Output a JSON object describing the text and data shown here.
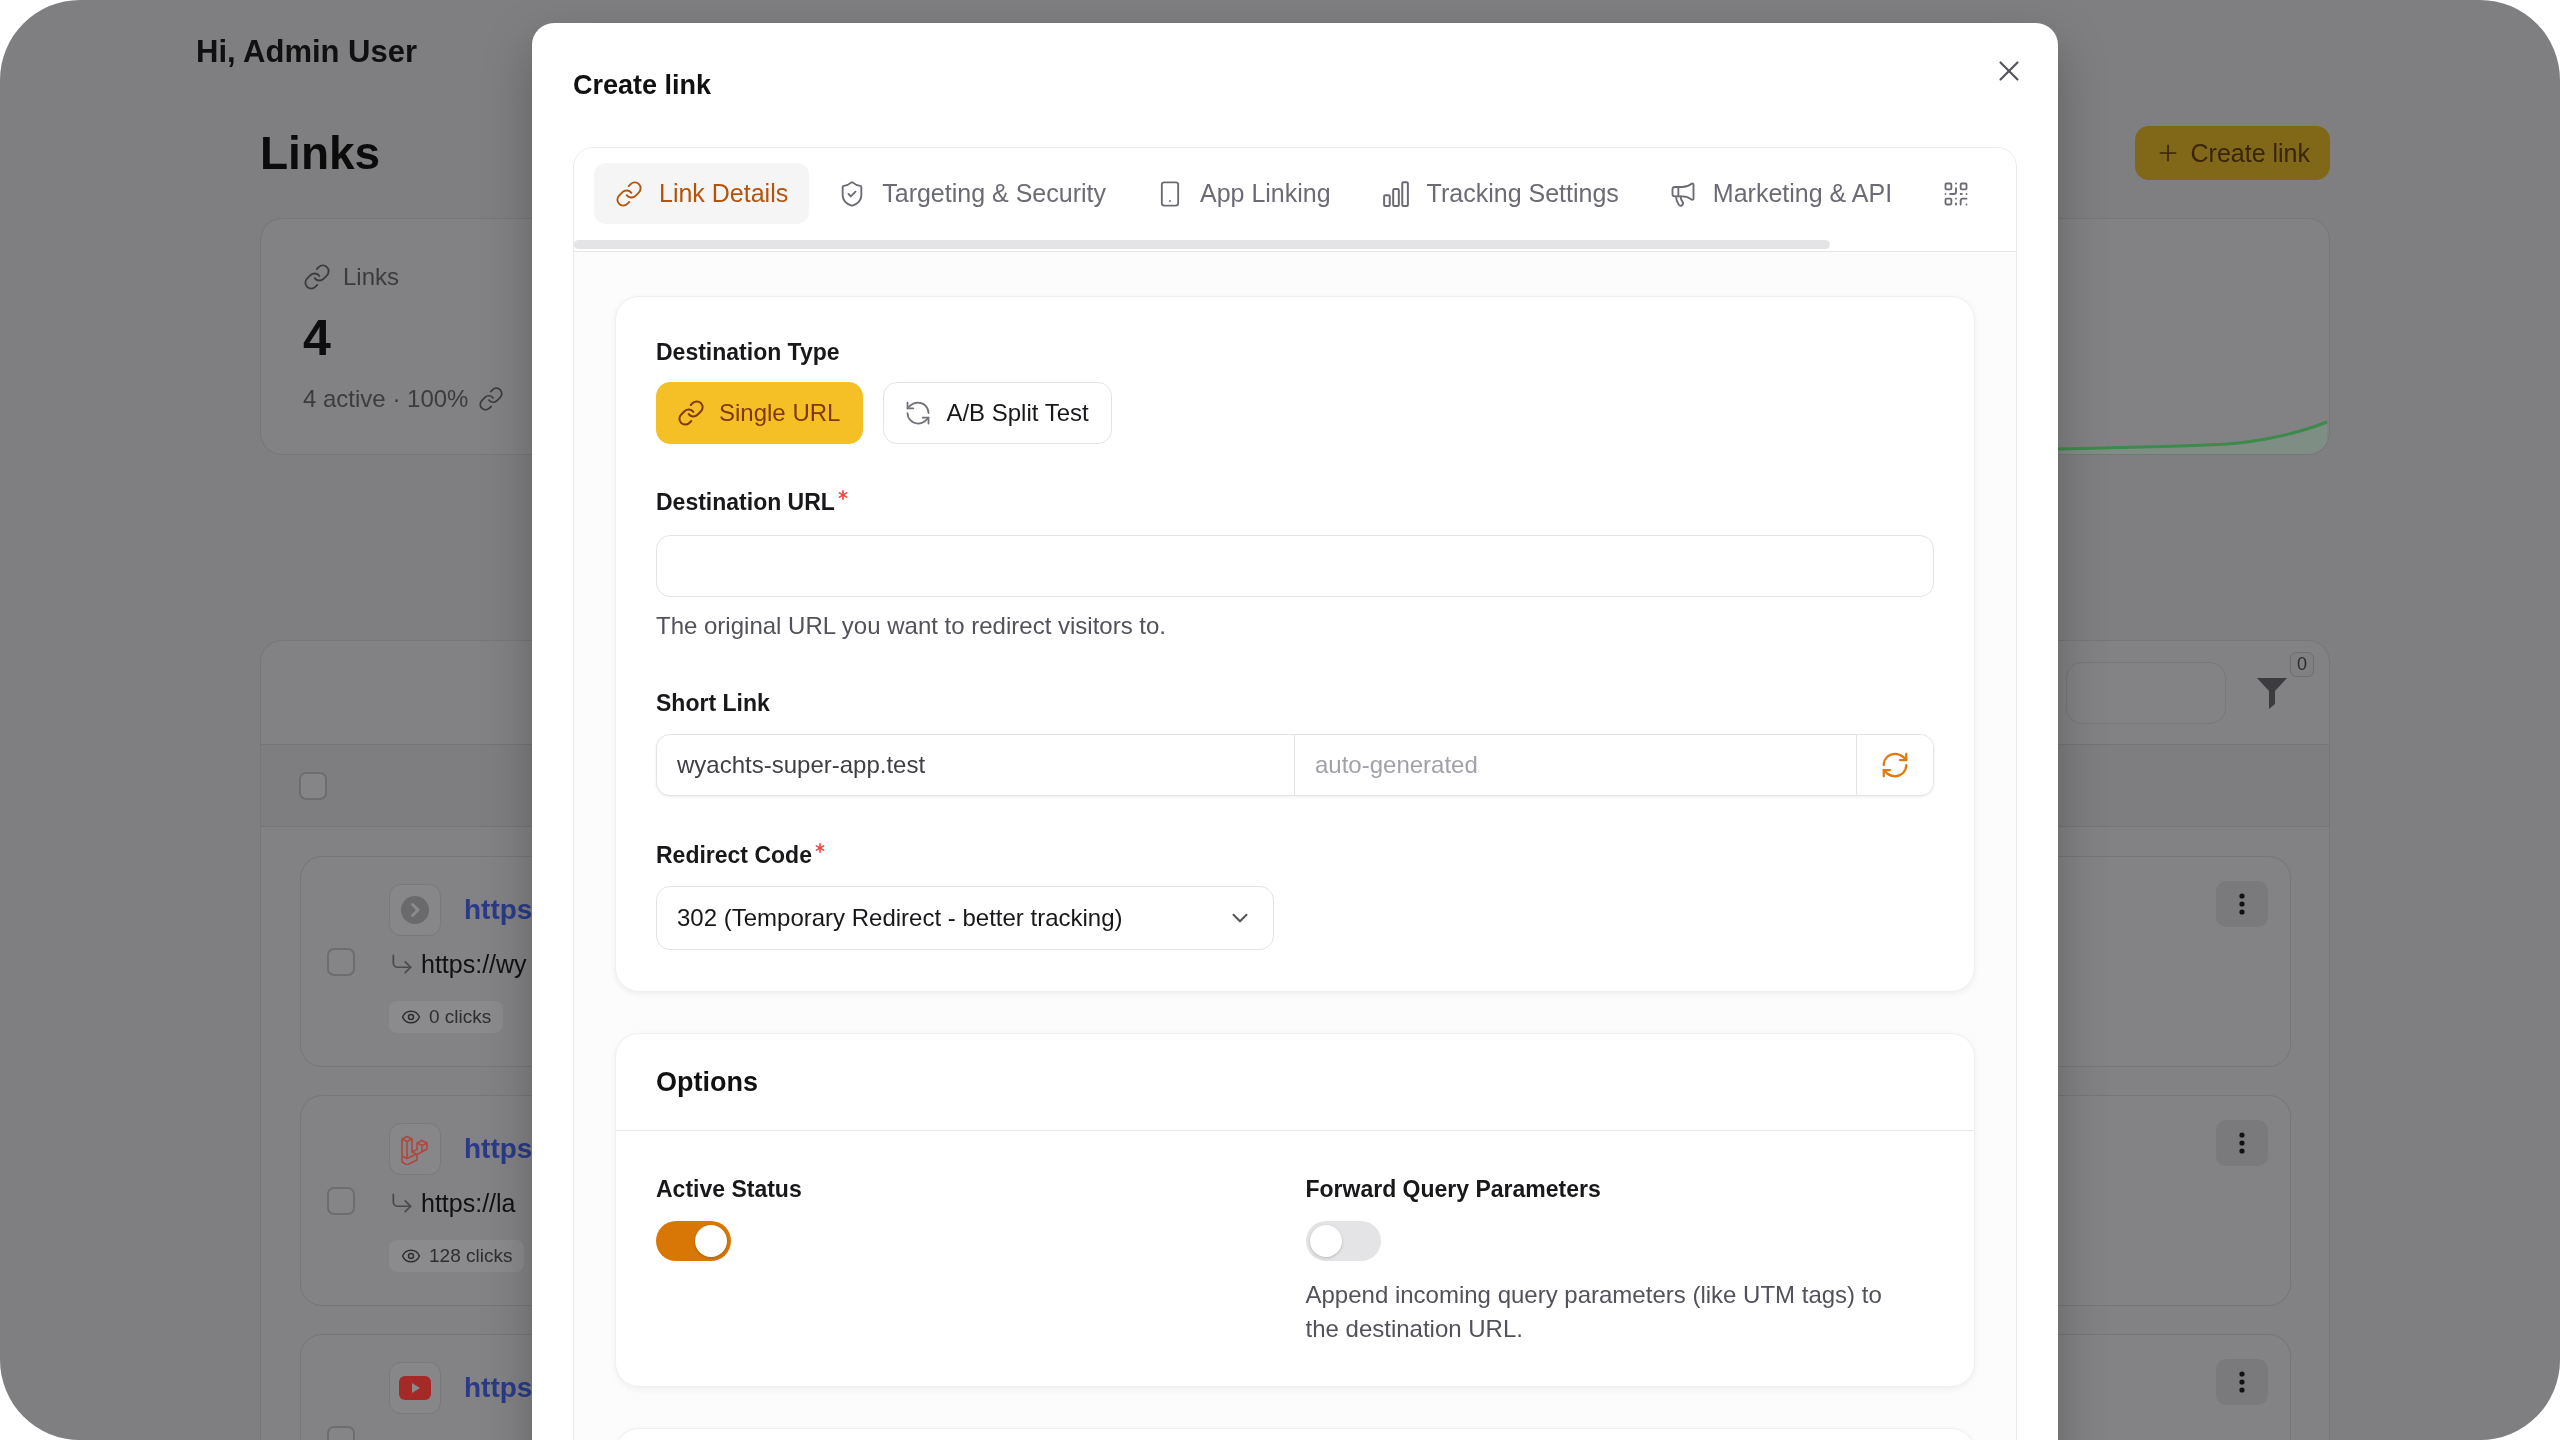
{
  "greeting": "Hi, Admin User",
  "header": {
    "title": "Links",
    "create_button": "Create link"
  },
  "stats": {
    "label": "Links",
    "value": "4",
    "detail": "4 active · 100%"
  },
  "table": {
    "filter_count": "0",
    "select_all": {
      "checked": false
    },
    "rows": [
      {
        "kind": "chevron",
        "title": "https",
        "destination": "https://wy",
        "clicks": "0 clicks",
        "checked": false
      },
      {
        "kind": "cubes",
        "title": "https",
        "destination": "https://la",
        "clicks": "128 clicks",
        "checked": false
      },
      {
        "kind": "play",
        "title": "https",
        "checked": false
      }
    ]
  },
  "modal": {
    "title": "Create link",
    "tabs": [
      {
        "label": "Link Details",
        "selected": true
      },
      {
        "label": "Targeting & Security",
        "selected": false
      },
      {
        "label": "App Linking",
        "selected": false
      },
      {
        "label": "Tracking Settings",
        "selected": false
      },
      {
        "label": "Marketing & API",
        "selected": false
      },
      {
        "selected": false
      }
    ],
    "destination_type": {
      "label": "Destination Type",
      "choices": [
        {
          "label": "Single URL",
          "selected": true
        },
        {
          "label": "A/B Split Test",
          "selected": false
        }
      ]
    },
    "destination_url": {
      "label": "Destination URL",
      "required": true,
      "help": "The original URL you want to redirect visitors to."
    },
    "short_link": {
      "label": "Short Link",
      "domain": "wyachts-super-app.test",
      "placeholder": "auto-generated"
    },
    "redirect_code": {
      "label": "Redirect Code",
      "required": true,
      "value": "302 (Temporary Redirect - better tracking)"
    },
    "options": {
      "title": "Options",
      "items": [
        {
          "label": "Active Status",
          "on": true
        },
        {
          "label": "Forward Query Parameters",
          "on": false,
          "description": "Append incoming query parameters (like UTM tags) to the destination URL."
        }
      ]
    }
  }
}
